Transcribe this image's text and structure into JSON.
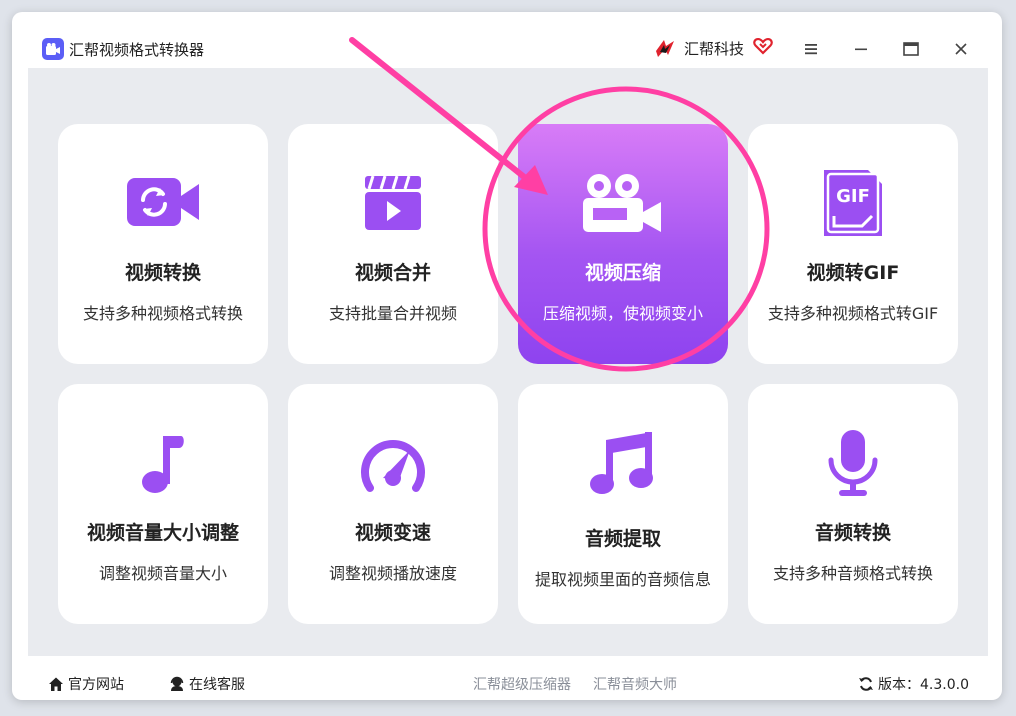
{
  "window": {
    "title": "汇帮视频格式转换器"
  },
  "brand": {
    "name": "汇帮科技"
  },
  "colors": {
    "accent": "#9b4ff2",
    "highlight": "#ff3fa4",
    "active_card_top": "#d87cf7",
    "active_card_bottom": "#8e43ef"
  },
  "cards": [
    {
      "title": "视频转换",
      "desc": "支持多种视频格式转换",
      "icon": "video-convert-icon"
    },
    {
      "title": "视频合并",
      "desc": "支持批量合并视频",
      "icon": "clapperboard-icon"
    },
    {
      "title": "视频压缩",
      "desc": "压缩视频，使视频变小",
      "icon": "video-camera-icon",
      "selected": true
    },
    {
      "title": "视频转GIF",
      "desc": "支持多种视频格式转GIF",
      "icon": "gif-file-icon"
    },
    {
      "title": "视频音量大小调整",
      "desc": "调整视频音量大小",
      "icon": "music-note-icon"
    },
    {
      "title": "视频变速",
      "desc": "调整视频播放速度",
      "icon": "speedometer-icon"
    },
    {
      "title": "音频提取",
      "desc": "提取视频里面的音频信息",
      "icon": "music-notes-icon"
    },
    {
      "title": "音频转换",
      "desc": "支持多种音频格式转换",
      "icon": "microphone-icon"
    }
  ],
  "footer": {
    "website": "官方网站",
    "service": "在线客服",
    "link1": "汇帮超级压缩器",
    "link2": "汇帮音频大师",
    "version_label": "版本：",
    "version": "4.3.0.0"
  }
}
